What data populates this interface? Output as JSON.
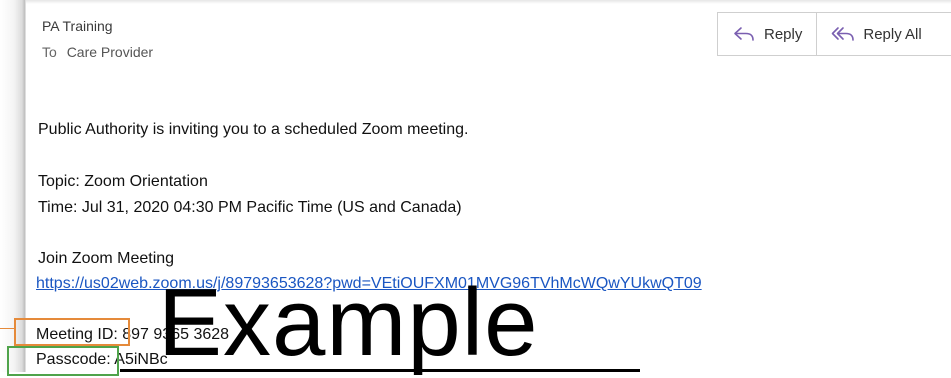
{
  "email": {
    "sender": "PA Training",
    "to_label": "To",
    "recipient": "Care Provider",
    "actions": {
      "reply_label": "Reply",
      "reply_all_label": "Reply All",
      "reply_icon": "reply-icon",
      "reply_all_icon": "reply-all-icon"
    },
    "body": {
      "intro": "Public Authority is inviting you to a scheduled Zoom meeting.",
      "topic": "Topic: Zoom Orientation",
      "time": "Time: Jul 31, 2020 04:30 PM Pacific Time (US and Canada)",
      "join_heading": "Join Zoom Meeting",
      "join_link": "https://us02web.zoom.us/j/89793653628?pwd=VEtiOUFXM01MVG96TVhMcWQwYUkwQT09",
      "meeting_id": "Meeting ID: 897 9365 3628",
      "passcode": "Passcode: A5iNBc"
    }
  },
  "overlay": {
    "watermark": "Example",
    "highlight_colors": {
      "meeting_id": "#e58a3a",
      "passcode": "#4fa34a"
    }
  }
}
